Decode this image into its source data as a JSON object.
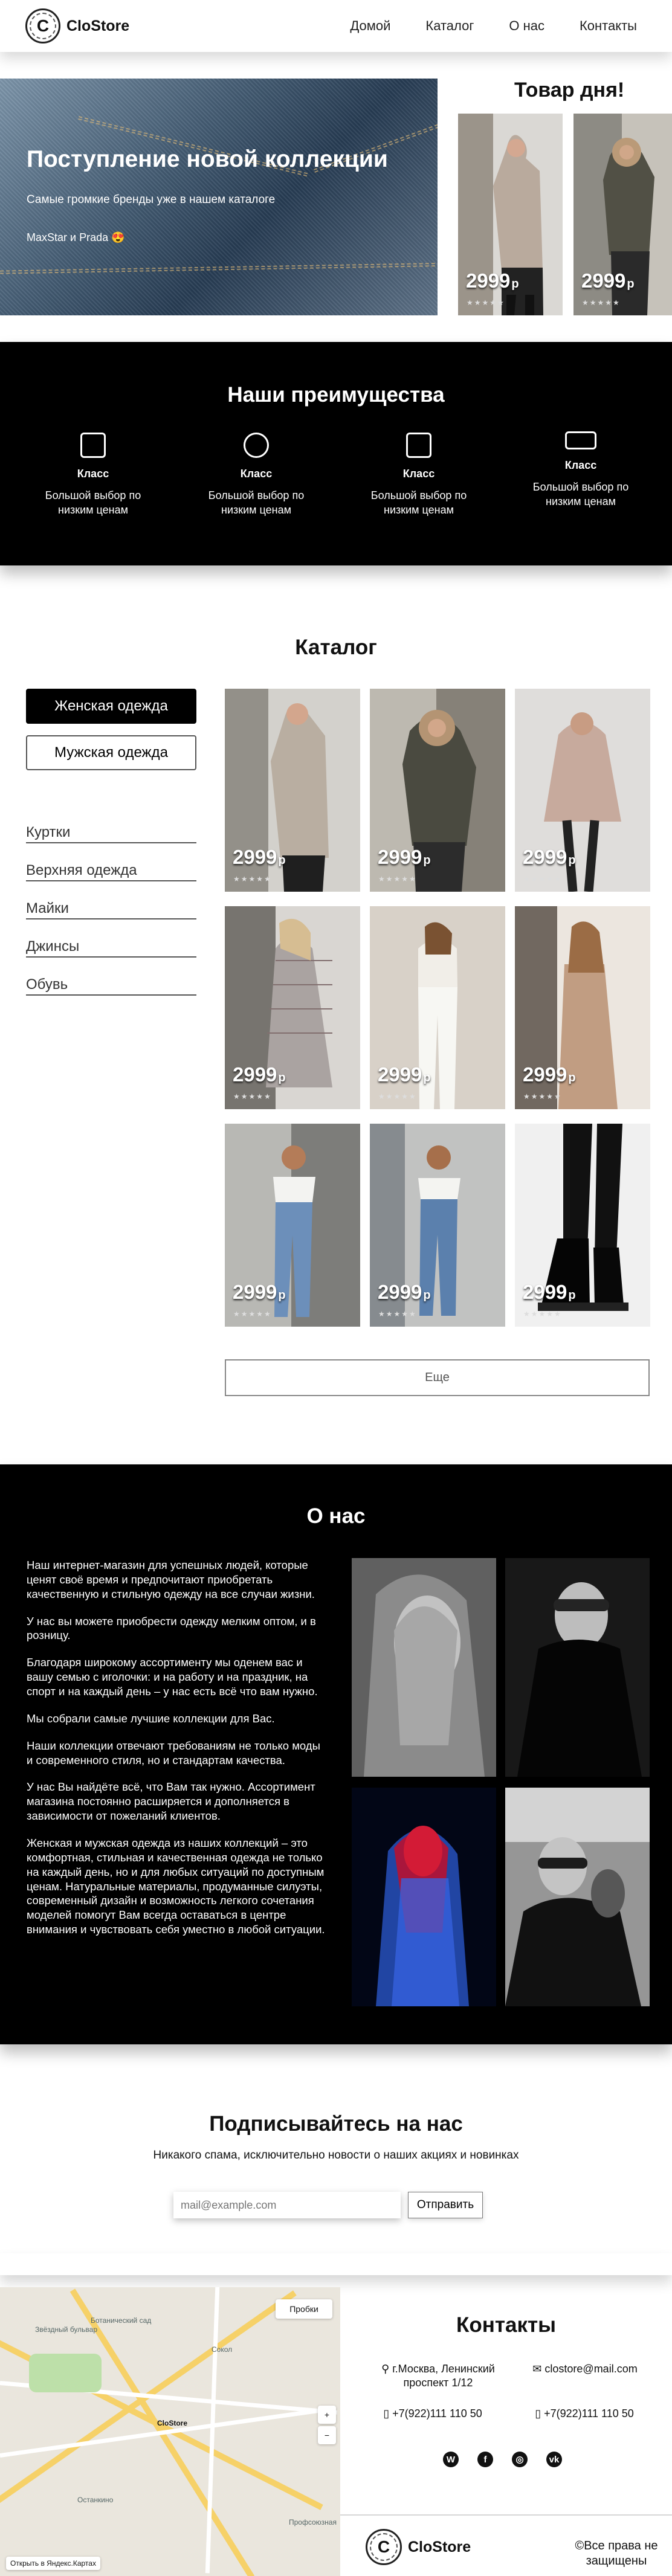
{
  "header": {
    "brand": "CloStore",
    "nav": [
      "Домой",
      "Каталог",
      "О нас",
      "Контакты"
    ]
  },
  "hero": {
    "title": "Поступление новой коллекции",
    "subtitle": "Самые громкие бренды уже в нашем каталоге",
    "brands": "MaxStar и Prada 😍",
    "deal_title": "Товар дня!",
    "deal_prices": [
      "2999",
      "2999"
    ]
  },
  "advantages": {
    "title": "Наши преимущества",
    "items": [
      {
        "name": "Класс",
        "text": "Большой выбор по низким ценам",
        "icon": "newspaper-icon"
      },
      {
        "name": "Класс",
        "text": "Большой выбор по низким ценам",
        "icon": "user-support-icon"
      },
      {
        "name": "Класс",
        "text": "Большой выбор по низким ценам",
        "icon": "archive-box-icon"
      },
      {
        "name": "Класс",
        "text": "Большой выбор по низким ценам",
        "icon": "credit-card-icon"
      }
    ]
  },
  "catalog": {
    "title": "Каталог",
    "buttons": [
      "Женская одежда",
      "Мужская одежда"
    ],
    "categories": [
      "Куртки",
      "Верхняя одежда",
      "Майки",
      "Джинсы",
      "Обувь"
    ],
    "prices": [
      "2999",
      "2999",
      "2999",
      "2999",
      "2999",
      "2999",
      "2999",
      "2999",
      "2999"
    ],
    "more": "Еще"
  },
  "about": {
    "title": "О нас",
    "paragraphs": [
      "Наш интернет-магазин для успешных людей, которые ценят своё время и предпочитают приобретать качественную и стильную одежду на все случаи жизни.",
      "У нас вы можете приобрести одежду мелким оптом, и в розницу.",
      "Благодаря широкому ассортименту мы оденем вас и вашу семью с иголочки: и на работу и на праздник, на спорт и на каждый день – у нас есть всё что вам нужно.",
      "Мы собрали самые лучшие коллекции для Вас.",
      "Наши коллекции отвечают требованиям не только моды и современного стиля, но и стандартам качества.",
      "У нас Вы найдёте всё, что Вам так нужно. Ассортимент магазина постоянно расширяется и дополняется в зависимости от пожеланий клиентов.",
      "Женская и мужская одежда из наших коллекций – это комфортная, стильная и качественная одежда не только на каждый день, но и для любых ситуаций по доступным ценам. Натуральные материалы, продуманные силуэты, современный дизайн и возможность легкого сочетания моделей помогут Вам всегда оставаться в центре внимания и чувствовать себя уместно в любой ситуации."
    ]
  },
  "subscribe": {
    "title": "Подписывайтесь на нас",
    "text": "Никакого спама, исключительно новости о наших акциях и новинках",
    "placeholder": "mail@example.com",
    "button": "Отправить"
  },
  "map": {
    "traffic": "Пробки",
    "open": "Открыть в Яндекс.Картах",
    "labels": [
      "Звёздный бульвар",
      "Ботанический сад",
      "Сокол",
      "Профсоюзная",
      "CloStore",
      "Останкино"
    ]
  },
  "contacts": {
    "title": "Контакты",
    "address": "г.Москва, Ленинский проспект 1/12",
    "email": "clostore@mail.com",
    "phone1": "+7(922)111 110 50",
    "phone2": "+7(922)111 110 50",
    "copyright": "©Все права не защищены"
  },
  "colors": {
    "black": "#000000",
    "accent": "#ffffff"
  }
}
